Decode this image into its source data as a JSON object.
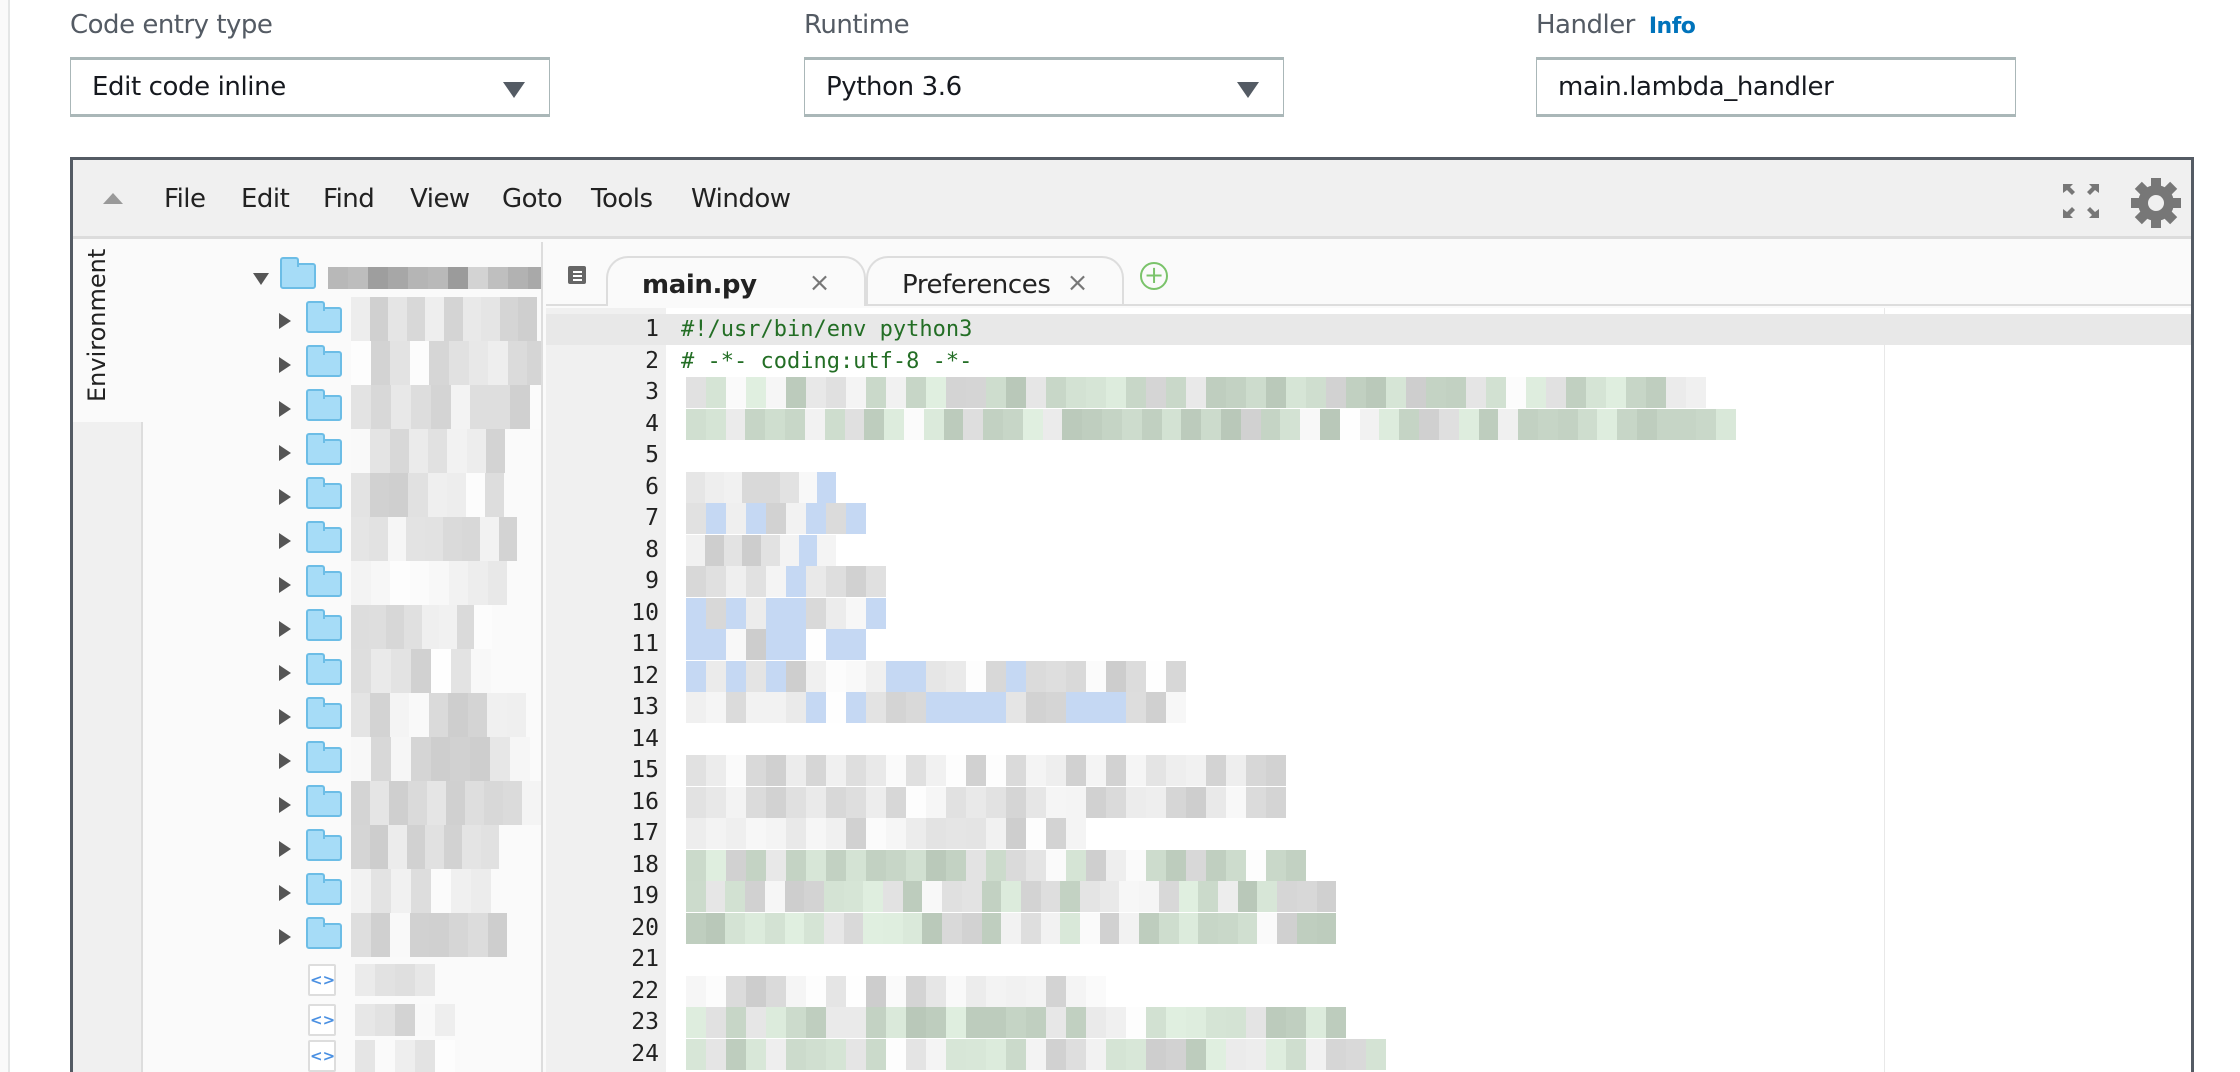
{
  "form": {
    "code_entry_type": {
      "label": "Code entry type",
      "value": "Edit code inline"
    },
    "runtime": {
      "label": "Runtime",
      "value": "Python 3.6"
    },
    "handler": {
      "label": "Handler",
      "info": "Info",
      "value": "main.lambda_handler"
    }
  },
  "editor": {
    "menu": [
      "File",
      "Edit",
      "Find",
      "View",
      "Goto",
      "Tools",
      "Window"
    ],
    "icons": {
      "collapse": "triangle-up-icon",
      "fullscreen": "expand-icon",
      "settings": "gear-icon"
    },
    "side_tab": "Environment",
    "tabs": [
      {
        "label": "main.py",
        "active": true
      },
      {
        "label": "Preferences",
        "active": false
      }
    ],
    "close_glyph": "×",
    "add_glyph": "+",
    "code_lines": [
      "#!/usr/bin/env python3",
      "# -*- coding:utf-8 -*-"
    ],
    "line_numbers": [
      "1",
      "2",
      "3",
      "4",
      "5",
      "6",
      "7",
      "8",
      "9",
      "10",
      "11",
      "12",
      "13",
      "14",
      "15",
      "16",
      "17",
      "18",
      "19",
      "20",
      "21",
      "22",
      "23",
      "24"
    ],
    "colors": {
      "accent_link": "#0073bb",
      "comment": "#236e25",
      "folder": "#a6dcf7"
    }
  }
}
